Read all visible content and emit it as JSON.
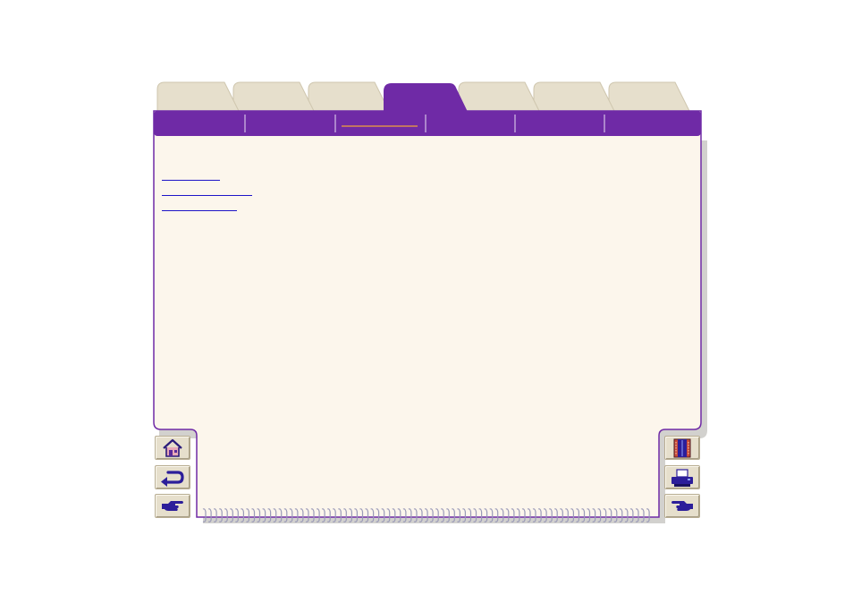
{
  "tabs": [
    {
      "label": "",
      "active": false
    },
    {
      "label": "",
      "active": false
    },
    {
      "label": "",
      "active": false
    },
    {
      "label": "",
      "active": true
    },
    {
      "label": "",
      "active": false
    },
    {
      "label": "",
      "active": false
    },
    {
      "label": "",
      "active": false
    }
  ],
  "subtabs": [
    {
      "label": "",
      "active": false
    },
    {
      "label": "",
      "active": false
    },
    {
      "label": "",
      "active": true
    },
    {
      "label": "",
      "active": false
    },
    {
      "label": "",
      "active": false
    },
    {
      "label": "",
      "active": false
    }
  ],
  "links": [
    {
      "text": ""
    },
    {
      "text": ""
    },
    {
      "text": ""
    }
  ],
  "nav": {
    "left": [
      {
        "icon": "home-icon"
      },
      {
        "icon": "back-arrow-icon"
      },
      {
        "icon": "pointing-hand-right-icon"
      }
    ],
    "right": [
      {
        "icon": "book-index-icon"
      },
      {
        "icon": "printer-icon"
      },
      {
        "icon": "pointing-hand-left-icon"
      }
    ]
  },
  "colors": {
    "purple": "#6f2aa6",
    "page": "#fcf6ec",
    "tab": "#e6dfcc",
    "link": "#1e14c8",
    "active_underline": "#f2a23a"
  }
}
